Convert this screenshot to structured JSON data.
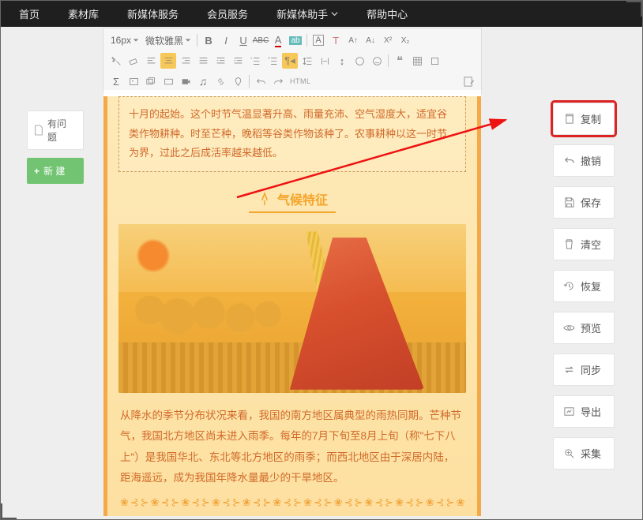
{
  "nav": {
    "home": "首页",
    "library": "素材库",
    "service": "新媒体服务",
    "member": "会员服务",
    "assistant": "新媒体助手",
    "help": "帮助中心"
  },
  "toolbar": {
    "font_size": "16px",
    "font_family": "微软雅黑",
    "html": "HTML"
  },
  "left": {
    "issue": "有问题",
    "new": "新 建"
  },
  "right": {
    "copy": "复制",
    "undo": "撤销",
    "save": "保存",
    "clear": "清空",
    "restore": "恢复",
    "preview": "预览",
    "sync": "同步",
    "export": "导出",
    "collect": "采集"
  },
  "content": {
    "block1": "十月的起始。这个时节气温显著升高、雨量充沛、空气湿度大，适宜谷类作物耕种。时至芒种，晚稻等谷类作物该种了。农事耕种以这一时节为界，过此之后成活率越来越低。",
    "heading": "气候特征",
    "para": "从降水的季节分布状况来看，我国的南方地区属典型的雨热同期。芒种节气，我国北方地区尚未进入雨季。每年的7月下旬至8月上旬（称\"七下八上\"）是我国华北、东北等北方地区的雨季；而西北地区由于深居内陆，距海遥远，成为我国年降水量最少的干旱地区。",
    "deco": "❀⊰⊱❀⊰⊱❀⊰⊱❀⊰⊱❀⊰⊱❀⊰⊱❀⊰⊱❀⊰⊱❀⊰⊱❀⊰⊱❀⊰⊱❀⊰⊱❀"
  }
}
